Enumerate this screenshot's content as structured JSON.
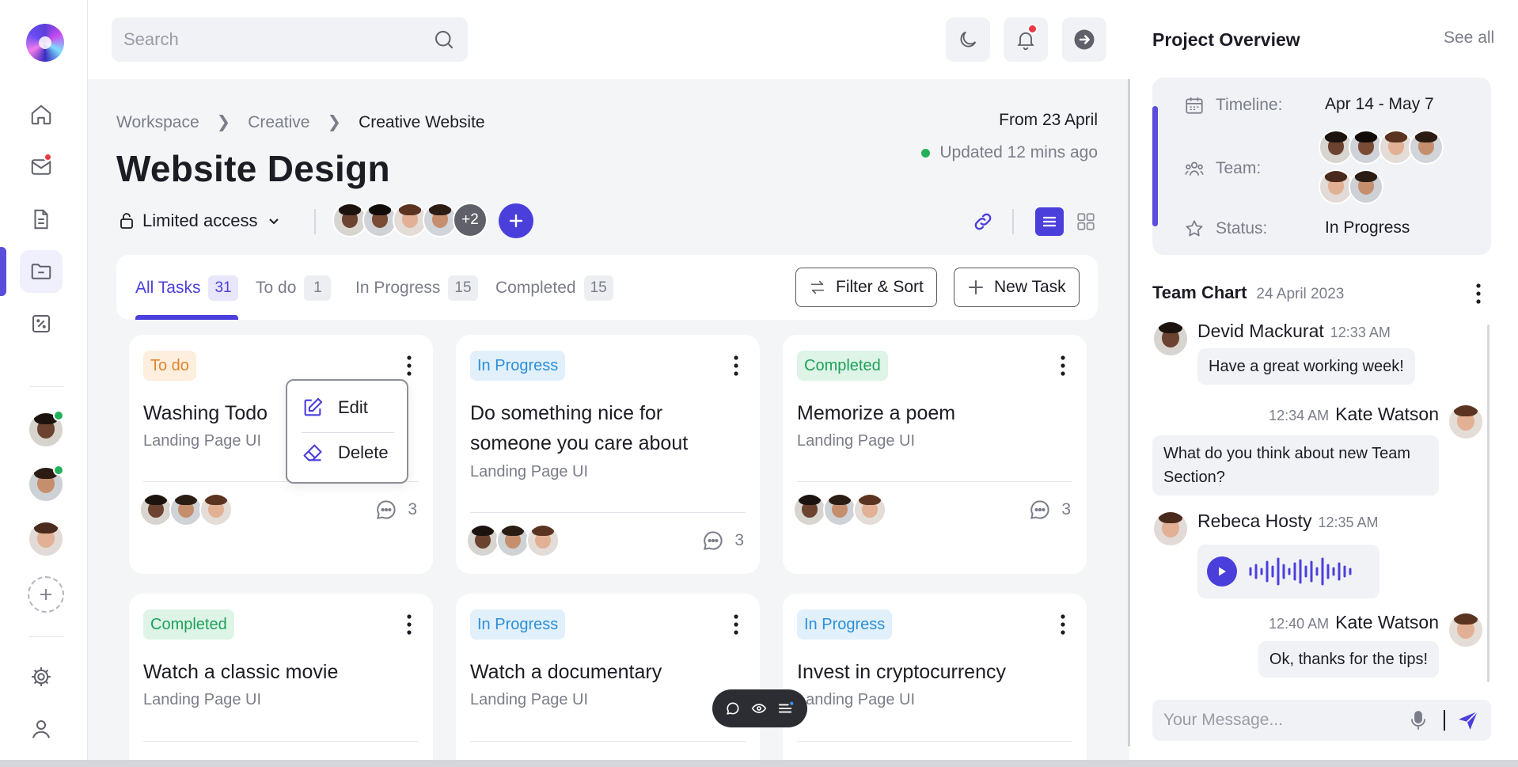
{
  "search": {
    "placeholder": "Search"
  },
  "sidebar": {
    "items": [
      {
        "name": "home",
        "icon": "home-icon"
      },
      {
        "name": "mail",
        "icon": "mail-icon"
      },
      {
        "name": "documents",
        "icon": "document-icon"
      },
      {
        "name": "folder",
        "icon": "folder-icon"
      },
      {
        "name": "percent",
        "icon": "percent-icon"
      }
    ],
    "active": "folder"
  },
  "breadcrumb": [
    "Workspace",
    "Creative",
    "Creative Website"
  ],
  "page": {
    "title": "Website Design",
    "from_date": "From 23 April",
    "updated": "Updated 12 mins ago",
    "access_label": "Limited access",
    "more_members": "+2"
  },
  "tabs": [
    {
      "label": "All Tasks",
      "count": "31"
    },
    {
      "label": "To do",
      "count": "1"
    },
    {
      "label": "In Progress",
      "count": "15"
    },
    {
      "label": "Completed",
      "count": "15"
    }
  ],
  "toolbar": {
    "filter_label": "Filter & Sort",
    "new_task_label": "New Task"
  },
  "tasks": [
    {
      "status": "To do",
      "title": "Washing Todo",
      "subtitle": "Landing Page UI",
      "comments": "3"
    },
    {
      "status": "In Progress",
      "title": "Do something nice for someone you care about",
      "subtitle": "Landing Page UI",
      "comments": "3"
    },
    {
      "status": "Completed",
      "title": "Memorize a poem",
      "subtitle": "Landing Page UI",
      "comments": "3"
    },
    {
      "status": "Completed",
      "title": "Watch a classic movie",
      "subtitle": "Landing Page UI"
    },
    {
      "status": "In Progress",
      "title": "Watch a documentary",
      "subtitle": "Landing Page UI"
    },
    {
      "status": "In Progress",
      "title": "Invest in cryptocurrency",
      "subtitle": "Landing Page UI"
    }
  ],
  "context_menu": {
    "edit": "Edit",
    "delete": "Delete"
  },
  "overview": {
    "title": "Project Overview",
    "see_all": "See all",
    "timeline_label": "Timeline:",
    "timeline_value": "Apr 14 - May 7",
    "team_label": "Team:",
    "status_label": "Status:",
    "status_value": "In Progress"
  },
  "chat": {
    "title": "Team Chart",
    "date": "24 April 2023",
    "messages": [
      {
        "author": "Devid Mackurat",
        "time": "12:33 AM",
        "text": "Have a great working week!"
      },
      {
        "author": "Kate Watson",
        "time": "12:34 AM",
        "text": "What do you think about new Team Section?"
      },
      {
        "author": "Rebeca Hosty",
        "time": "12:35 AM",
        "text": ""
      },
      {
        "author": "Kate Watson",
        "time": "12:40 AM",
        "text": "Ok, thanks for the tips!"
      }
    ],
    "input_placeholder": "Your Message..."
  },
  "colors": {
    "accent": "#4b3fdc",
    "todo": "#e0852b",
    "in_progress": "#2c8fd8",
    "completed": "#1fa15a",
    "online": "#22b15a",
    "notification": "#ea3943"
  }
}
